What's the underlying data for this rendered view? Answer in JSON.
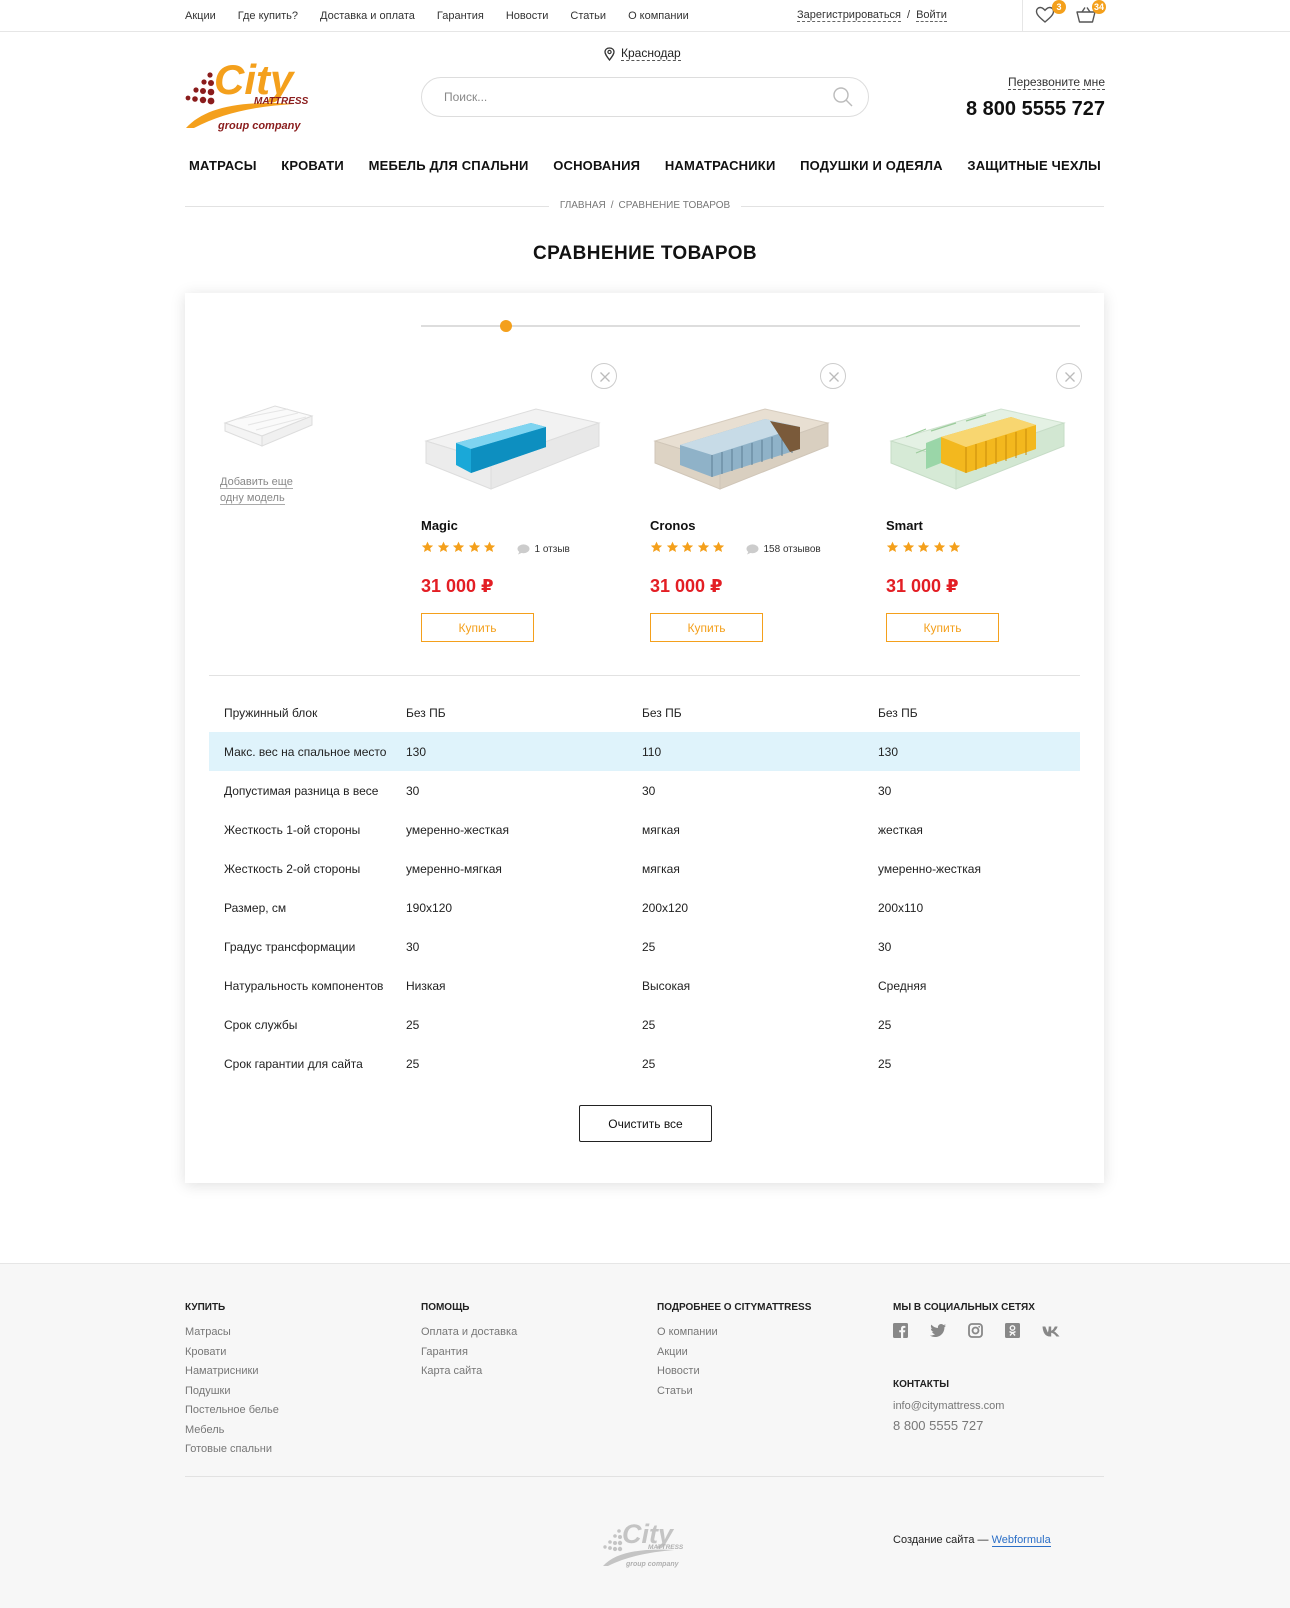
{
  "topbar": {
    "nav": [
      "Акции",
      "Где купить?",
      "Доставка и оплата",
      "Гарантия",
      "Новости",
      "Статьи",
      "О компании"
    ],
    "register": "Зарегистрироваться",
    "auth_sep": "/",
    "login": "Войти",
    "favorites_count": "3",
    "cart_count": "34"
  },
  "header": {
    "logo_text": "City",
    "logo_sub": "MATTRESS",
    "logo_tagline": "group company",
    "city": "Краснодар",
    "search_placeholder": "Поиск...",
    "callback": "Перезвоните мне",
    "phone": "8 800 5555 727"
  },
  "main_nav": [
    "МАТРАСЫ",
    "КРОВАТИ",
    "МЕБЕЛЬ ДЛЯ СПАЛЬНИ",
    "ОСНОВАНИЯ",
    "НАМАТРАСНИКИ",
    "ПОДУШКИ И ОДЕЯЛА",
    "ЗАЩИТНЫЕ ЧЕХЛЫ"
  ],
  "breadcrumb": {
    "home": "ГЛАВНАЯ",
    "sep": "/",
    "current": "СРАВНЕНИЕ ТОВАРОВ"
  },
  "page_title": "СРАВНЕНИЕ ТОВАРОВ",
  "add_more": {
    "line1": "Добавить еще",
    "line2": "одну модель"
  },
  "products": [
    {
      "name": "Magic",
      "rating": 5,
      "reviews": "1 отзыв",
      "price": "31 000 ₽",
      "buy_label": "Купить",
      "colors": {
        "core": "#1aa8d8",
        "cover": "#f2f2f2"
      }
    },
    {
      "name": "Cronos",
      "rating": 5,
      "reviews": "158 отзывов",
      "price": "31 000 ₽",
      "buy_label": "Купить",
      "colors": {
        "core": "#8fb2c8",
        "cover": "#e8dfd2"
      }
    },
    {
      "name": "Smart",
      "rating": 5,
      "reviews": "",
      "price": "31 000 ₽",
      "buy_label": "Купить",
      "colors": {
        "core": "#f3b81e",
        "cover": "#e4f1e4"
      }
    }
  ],
  "specs": [
    {
      "label": "Пружинный блок",
      "values": [
        "Без ПБ",
        "Без ПБ",
        "Без ПБ"
      ],
      "highlight": false
    },
    {
      "label": "Макс. вес на спальное место",
      "values": [
        "130",
        "110",
        "130"
      ],
      "highlight": true
    },
    {
      "label": "Допустимая разница в весе",
      "values": [
        "30",
        "30",
        "30"
      ],
      "highlight": false
    },
    {
      "label": "Жесткость 1-ой стороны",
      "values": [
        "умеренно-жесткая",
        "мягкая",
        "жесткая"
      ],
      "highlight": false
    },
    {
      "label": "Жесткость 2-ой стороны",
      "values": [
        "умеренно-мягкая",
        "мягкая",
        "умеренно-жесткая"
      ],
      "highlight": false
    },
    {
      "label": "Размер, см",
      "values": [
        "190x120",
        "200x120",
        "200x110"
      ],
      "highlight": false
    },
    {
      "label": "Градус трансформации",
      "values": [
        "30",
        "25",
        "30"
      ],
      "highlight": false
    },
    {
      "label": "Натуральность компонентов",
      "values": [
        "Низкая",
        "Высокая",
        "Средняя"
      ],
      "highlight": false
    },
    {
      "label": "Срок службы",
      "values": [
        "25",
        "25",
        "25"
      ],
      "highlight": false
    },
    {
      "label": "Срок гарантии для сайта",
      "values": [
        "25",
        "25",
        "25"
      ],
      "highlight": false
    }
  ],
  "clear_all": "Очистить все",
  "footer": {
    "buy": {
      "title": "КУПИТЬ",
      "links": [
        "Матрасы",
        "Кровати",
        "Наматрисники",
        "Подушки",
        "Постельное белье",
        "Мебель",
        "Готовые спальни"
      ]
    },
    "help": {
      "title": "ПОМОЩЬ",
      "links": [
        "Оплата и доставка",
        "Гарантия",
        "Карта сайта"
      ]
    },
    "about": {
      "title": "ПОДРОБНЕЕ О CITYMATTRESS",
      "links": [
        "О компании",
        "Акции",
        "Новости",
        "Статьи"
      ]
    },
    "social": {
      "title": "МЫ В СОЦИАЛЬНЫХ СЕТЯХ",
      "icons": [
        "facebook-icon",
        "twitter-icon",
        "instagram-icon",
        "odnoklassniki-icon",
        "vk-icon"
      ]
    },
    "contacts": {
      "title": "КОНТАКТЫ",
      "email": "info@citymattress.com",
      "phone": "8 800 5555 727"
    },
    "credits_prefix": "Создание сайта —",
    "credits_link": "Webformula"
  },
  "colors": {
    "accent": "#f4a01c",
    "price": "#e31e24",
    "highlight_row": "#dff3fb",
    "link_blue": "#2b6fc7"
  }
}
